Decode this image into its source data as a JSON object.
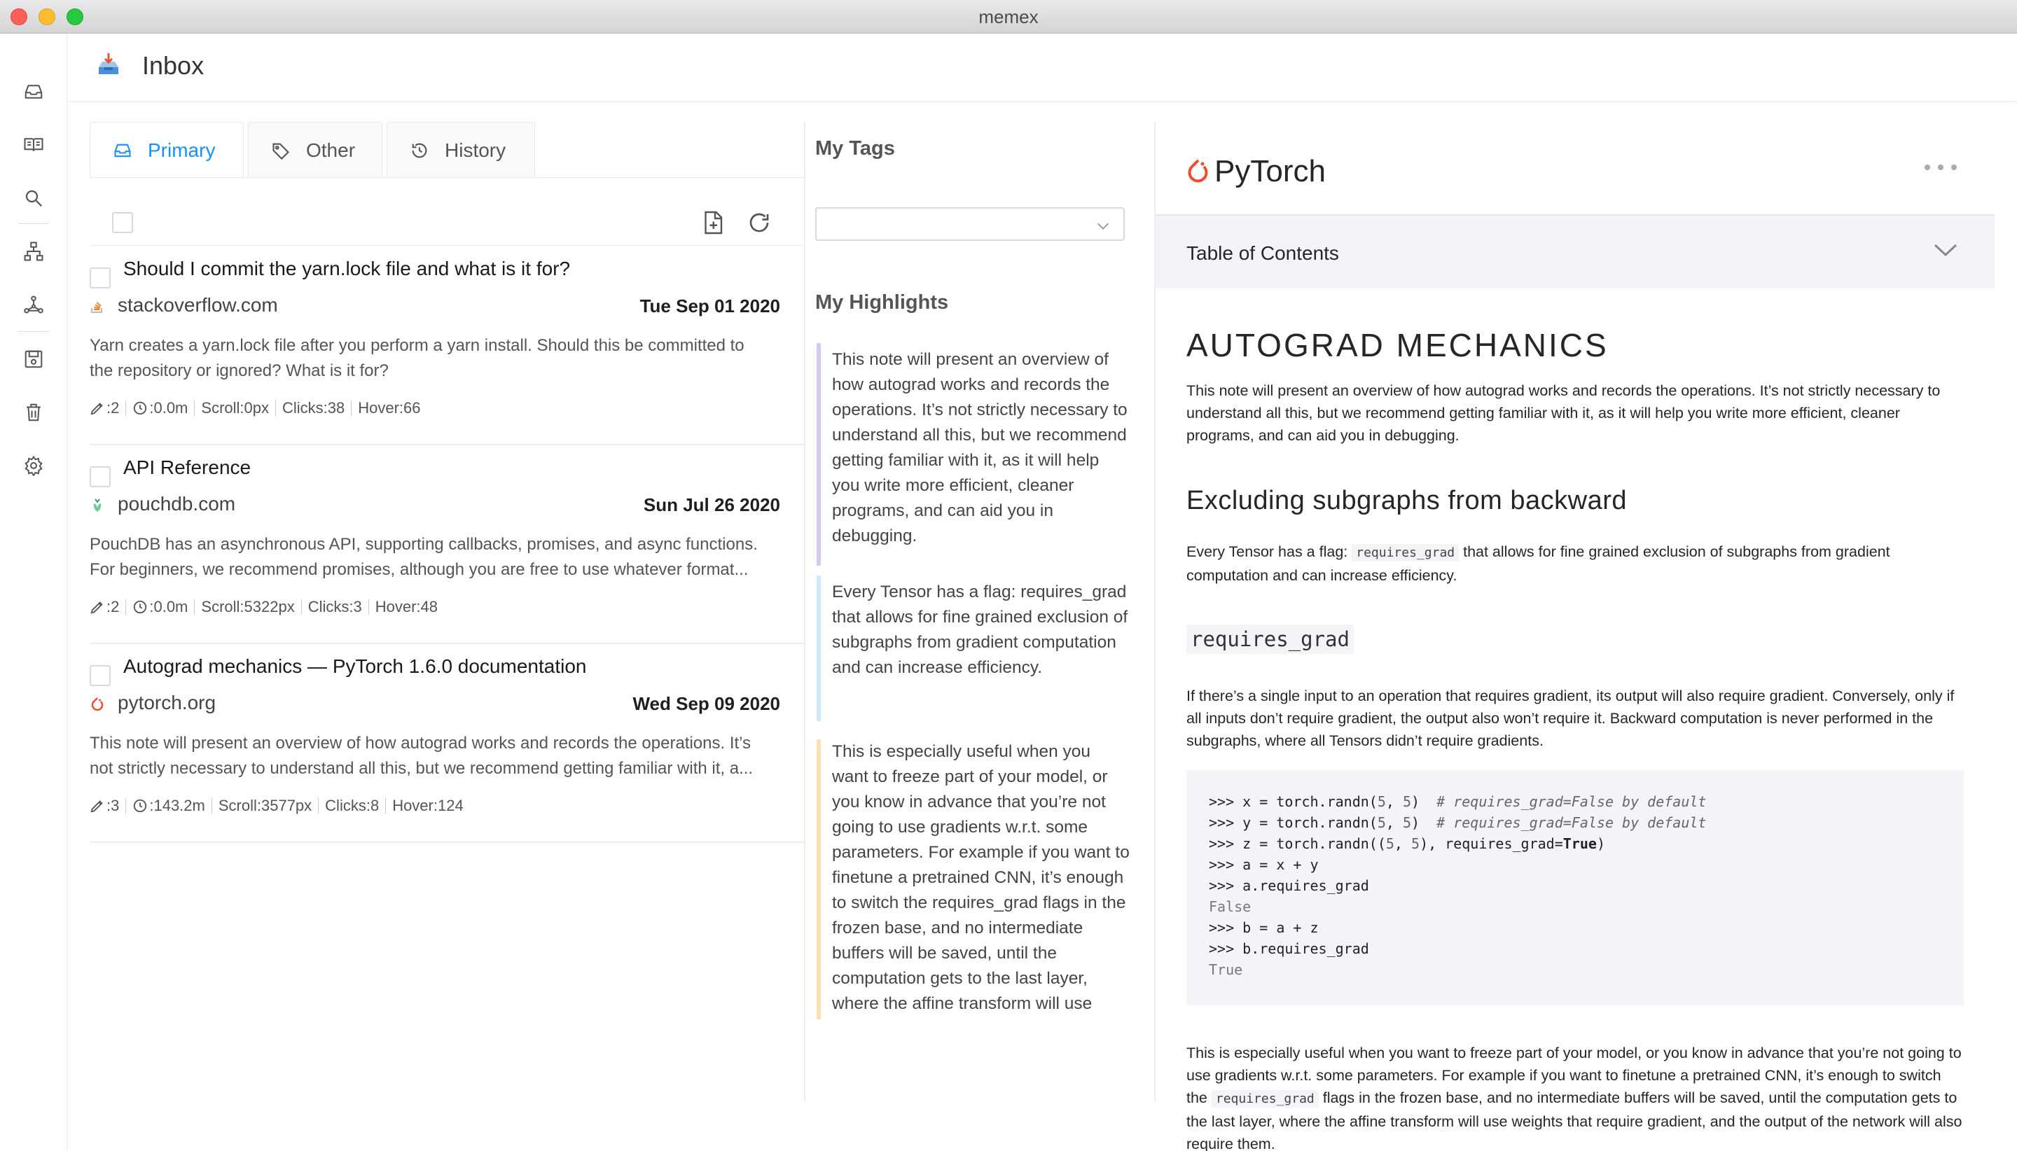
{
  "window": {
    "title": "memex"
  },
  "header": {
    "title": "Inbox"
  },
  "sidebar": {
    "icons": [
      "inbox-icon",
      "reader-icon",
      "search-icon",
      "sitemap-icon",
      "graph-icon",
      "save-icon",
      "trash-icon",
      "settings-icon"
    ]
  },
  "tabs": [
    {
      "label": "Primary",
      "icon": "inbox-icon"
    },
    {
      "label": "Other",
      "icon": "tag-icon"
    },
    {
      "label": "History",
      "icon": "history-icon"
    }
  ],
  "items": [
    {
      "title": "Should I commit the yarn.lock file and what is it for?",
      "site": "stackoverflow.com",
      "date": "Tue Sep 01 2020",
      "desc1": "Yarn creates a yarn.lock file after you perform a yarn install. Should this be committed to",
      "desc2": "the repository or ignored? What is it for?",
      "highlights": ":2",
      "time": ":0.0m",
      "scroll": "Scroll:0px",
      "clicks": "Clicks:38",
      "hover": "Hover:66"
    },
    {
      "title": "API Reference",
      "site": "pouchdb.com",
      "date": "Sun Jul 26 2020",
      "desc1": "PouchDB has an asynchronous API, supporting callbacks, promises, and async functions.",
      "desc2": "For beginners, we recommend promises, although you are free to use whatever format...",
      "highlights": ":2",
      "time": ":0.0m",
      "scroll": "Scroll:5322px",
      "clicks": "Clicks:3",
      "hover": "Hover:48"
    },
    {
      "title": "Autograd mechanics — PyTorch 1.6.0 documentation",
      "site": "pytorch.org",
      "date": "Wed Sep 09 2020",
      "desc1": "This note will present an overview of how autograd works and records the operations. It’s",
      "desc2": "not strictly necessary to understand all this, but we recommend getting familiar with it, a...",
      "highlights": ":3",
      "time": ":143.2m",
      "scroll": "Scroll:3577px",
      "clicks": "Clicks:8",
      "hover": "Hover:124"
    }
  ],
  "tags": {
    "heading": "My Tags",
    "select_value": ""
  },
  "highlights": {
    "heading": "My Highlights",
    "entries": [
      {
        "text": "This note will present an overview of how autograd works and records the operations. It’s not strictly necessary to understand all this, but we recommend getting familiar with it, as it will help you write more efficient, cleaner programs, and can aid you in debugging.",
        "color": "#d6c8f0"
      },
      {
        "text": "Every Tensor has a flag: requires_grad that allows for fine grained exclusion of subgraphs from gradient computation and can increase efficiency.",
        "color": "#cfe8f7"
      },
      {
        "text": "This is especially useful when you want to freeze part of your model, or you know in advance that you’re not going to use gradients w.r.t. some parameters. For example if you want to finetune a pretrained CNN, it’s enough to switch the requires_grad flags in the frozen base, and no intermediate buffers will be saved, until the computation gets to the last layer, where the affine transform will use weights that require gradient, and the output of the network will also require them",
        "color": "#f7e2b8"
      }
    ]
  },
  "reader": {
    "brand": "PyTorch",
    "toc_label": "Table of Contents",
    "h1": "AUTOGRAD MECHANICS",
    "p1": "This note will present an overview of how autograd works and records the operations. It’s not strictly necessary to understand all this, but we recommend getting familiar with it, as it will help you write more efficient, cleaner programs, and can aid you in debugging.",
    "h2": "Excluding subgraphs from backward",
    "p2_before": "Every Tensor has a flag: ",
    "p2_code": "requires_grad",
    "p2_after": " that allows for fine grained exclusion of subgraphs from gradient computation and can increase efficiency.",
    "h3": "requires_grad",
    "p3": "If there’s a single input to an operation that requires gradient, its output will also require gradient. Conversely, only if all inputs don’t require gradient, the output also won’t require it. Backward computation is never performed in the subgraphs, where all Tensors didn’t require gradients.",
    "p4_before": "This is especially useful when you want to freeze part of your model, or you know in advance that you’re not going to use gradients w.r.t. some parameters. For example if you want to finetune a pretrained CNN, it’s enough to switch the ",
    "p4_code": "requires_grad",
    "p4_after": " flags in the frozen base, and no intermediate buffers will be saved, until the computation gets to the last layer, where the affine transform will use weights that require gradient, and the output of the network will also require them."
  },
  "colors": {
    "accent": "#1890ff",
    "pytorch": "#ee4c2c"
  }
}
